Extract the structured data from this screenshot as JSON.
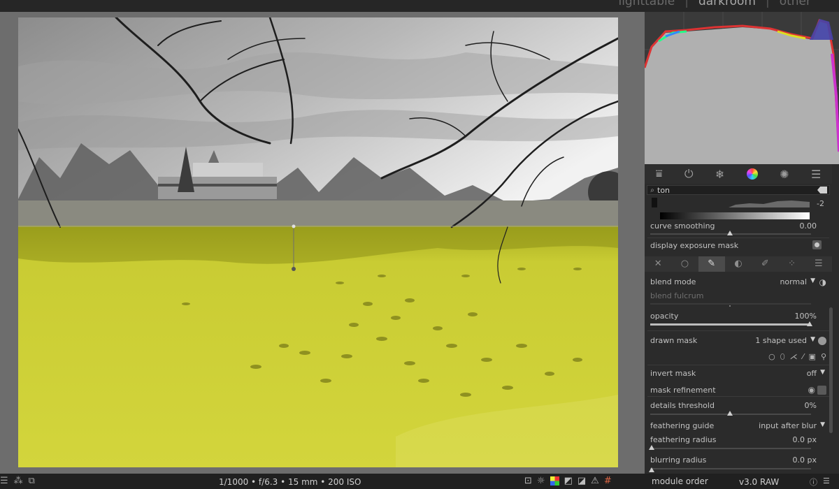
{
  "views": {
    "lighttable": "lighttable",
    "darkroom": "darkroom",
    "other": "other",
    "separator": "|"
  },
  "groups": {
    "icons": [
      "sliders-icon",
      "power-icon",
      "snowflake-icon",
      "color-wheel-icon",
      "fx-icon",
      "menu-icon"
    ]
  },
  "search": {
    "value": "ton"
  },
  "tone_module": {
    "exposure_value": "-2",
    "curve_smoothing_label": "curve smoothing",
    "curve_smoothing_value": "0.00",
    "display_exposure_mask_label": "display exposure mask"
  },
  "blending": {
    "tabs": [
      "off",
      "uniform",
      "drawn",
      "parametric",
      "drawn-parametric",
      "raster"
    ],
    "blend_mode_label": "blend mode",
    "blend_mode_value": "normal",
    "blend_fulcrum_label": "blend fulcrum",
    "opacity_label": "opacity",
    "opacity_value": "100%",
    "opacity_level": 1.0,
    "drawn_mask_label": "drawn mask",
    "drawn_mask_value": "1 shape used",
    "invert_mask_label": "invert mask",
    "invert_mask_value": "off",
    "mask_refinement_label": "mask refinement",
    "details_threshold_label": "details threshold",
    "details_threshold_value": "0%",
    "feathering_guide_label": "feathering guide",
    "feathering_guide_value": "input after blur",
    "feathering_radius_label": "feathering radius",
    "feathering_radius_value": "0.0 px",
    "blurring_radius_label": "blurring radius",
    "blurring_radius_value": "0.0 px"
  },
  "bottom": {
    "exif": "1/1000 • f/6.3 • 15 mm • 200 ISO",
    "module_order_label": "module order",
    "version": "v3.0 RAW"
  },
  "colors": {
    "mask_overlay": "#d2d43a",
    "panel_bg": "#2b2b2b",
    "active_tab": "#4b4b4b"
  }
}
